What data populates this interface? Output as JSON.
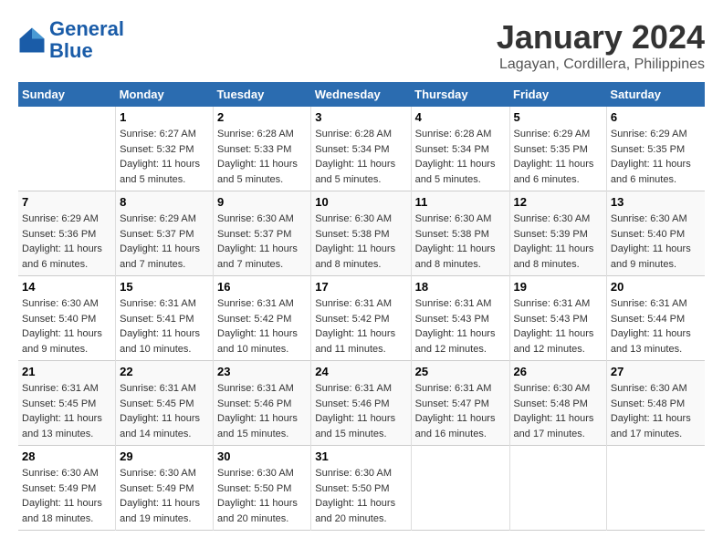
{
  "logo": {
    "line1": "General",
    "line2": "Blue"
  },
  "title": "January 2024",
  "location": "Lagayan, Cordillera, Philippines",
  "days_header": [
    "Sunday",
    "Monday",
    "Tuesday",
    "Wednesday",
    "Thursday",
    "Friday",
    "Saturday"
  ],
  "weeks": [
    [
      {
        "day": "",
        "sunrise": "",
        "sunset": "",
        "daylight": ""
      },
      {
        "day": "1",
        "sunrise": "Sunrise: 6:27 AM",
        "sunset": "Sunset: 5:32 PM",
        "daylight": "Daylight: 11 hours and 5 minutes."
      },
      {
        "day": "2",
        "sunrise": "Sunrise: 6:28 AM",
        "sunset": "Sunset: 5:33 PM",
        "daylight": "Daylight: 11 hours and 5 minutes."
      },
      {
        "day": "3",
        "sunrise": "Sunrise: 6:28 AM",
        "sunset": "Sunset: 5:34 PM",
        "daylight": "Daylight: 11 hours and 5 minutes."
      },
      {
        "day": "4",
        "sunrise": "Sunrise: 6:28 AM",
        "sunset": "Sunset: 5:34 PM",
        "daylight": "Daylight: 11 hours and 5 minutes."
      },
      {
        "day": "5",
        "sunrise": "Sunrise: 6:29 AM",
        "sunset": "Sunset: 5:35 PM",
        "daylight": "Daylight: 11 hours and 6 minutes."
      },
      {
        "day": "6",
        "sunrise": "Sunrise: 6:29 AM",
        "sunset": "Sunset: 5:35 PM",
        "daylight": "Daylight: 11 hours and 6 minutes."
      }
    ],
    [
      {
        "day": "7",
        "sunrise": "Sunrise: 6:29 AM",
        "sunset": "Sunset: 5:36 PM",
        "daylight": "Daylight: 11 hours and 6 minutes."
      },
      {
        "day": "8",
        "sunrise": "Sunrise: 6:29 AM",
        "sunset": "Sunset: 5:37 PM",
        "daylight": "Daylight: 11 hours and 7 minutes."
      },
      {
        "day": "9",
        "sunrise": "Sunrise: 6:30 AM",
        "sunset": "Sunset: 5:37 PM",
        "daylight": "Daylight: 11 hours and 7 minutes."
      },
      {
        "day": "10",
        "sunrise": "Sunrise: 6:30 AM",
        "sunset": "Sunset: 5:38 PM",
        "daylight": "Daylight: 11 hours and 8 minutes."
      },
      {
        "day": "11",
        "sunrise": "Sunrise: 6:30 AM",
        "sunset": "Sunset: 5:38 PM",
        "daylight": "Daylight: 11 hours and 8 minutes."
      },
      {
        "day": "12",
        "sunrise": "Sunrise: 6:30 AM",
        "sunset": "Sunset: 5:39 PM",
        "daylight": "Daylight: 11 hours and 8 minutes."
      },
      {
        "day": "13",
        "sunrise": "Sunrise: 6:30 AM",
        "sunset": "Sunset: 5:40 PM",
        "daylight": "Daylight: 11 hours and 9 minutes."
      }
    ],
    [
      {
        "day": "14",
        "sunrise": "Sunrise: 6:30 AM",
        "sunset": "Sunset: 5:40 PM",
        "daylight": "Daylight: 11 hours and 9 minutes."
      },
      {
        "day": "15",
        "sunrise": "Sunrise: 6:31 AM",
        "sunset": "Sunset: 5:41 PM",
        "daylight": "Daylight: 11 hours and 10 minutes."
      },
      {
        "day": "16",
        "sunrise": "Sunrise: 6:31 AM",
        "sunset": "Sunset: 5:42 PM",
        "daylight": "Daylight: 11 hours and 10 minutes."
      },
      {
        "day": "17",
        "sunrise": "Sunrise: 6:31 AM",
        "sunset": "Sunset: 5:42 PM",
        "daylight": "Daylight: 11 hours and 11 minutes."
      },
      {
        "day": "18",
        "sunrise": "Sunrise: 6:31 AM",
        "sunset": "Sunset: 5:43 PM",
        "daylight": "Daylight: 11 hours and 12 minutes."
      },
      {
        "day": "19",
        "sunrise": "Sunrise: 6:31 AM",
        "sunset": "Sunset: 5:43 PM",
        "daylight": "Daylight: 11 hours and 12 minutes."
      },
      {
        "day": "20",
        "sunrise": "Sunrise: 6:31 AM",
        "sunset": "Sunset: 5:44 PM",
        "daylight": "Daylight: 11 hours and 13 minutes."
      }
    ],
    [
      {
        "day": "21",
        "sunrise": "Sunrise: 6:31 AM",
        "sunset": "Sunset: 5:45 PM",
        "daylight": "Daylight: 11 hours and 13 minutes."
      },
      {
        "day": "22",
        "sunrise": "Sunrise: 6:31 AM",
        "sunset": "Sunset: 5:45 PM",
        "daylight": "Daylight: 11 hours and 14 minutes."
      },
      {
        "day": "23",
        "sunrise": "Sunrise: 6:31 AM",
        "sunset": "Sunset: 5:46 PM",
        "daylight": "Daylight: 11 hours and 15 minutes."
      },
      {
        "day": "24",
        "sunrise": "Sunrise: 6:31 AM",
        "sunset": "Sunset: 5:46 PM",
        "daylight": "Daylight: 11 hours and 15 minutes."
      },
      {
        "day": "25",
        "sunrise": "Sunrise: 6:31 AM",
        "sunset": "Sunset: 5:47 PM",
        "daylight": "Daylight: 11 hours and 16 minutes."
      },
      {
        "day": "26",
        "sunrise": "Sunrise: 6:30 AM",
        "sunset": "Sunset: 5:48 PM",
        "daylight": "Daylight: 11 hours and 17 minutes."
      },
      {
        "day": "27",
        "sunrise": "Sunrise: 6:30 AM",
        "sunset": "Sunset: 5:48 PM",
        "daylight": "Daylight: 11 hours and 17 minutes."
      }
    ],
    [
      {
        "day": "28",
        "sunrise": "Sunrise: 6:30 AM",
        "sunset": "Sunset: 5:49 PM",
        "daylight": "Daylight: 11 hours and 18 minutes."
      },
      {
        "day": "29",
        "sunrise": "Sunrise: 6:30 AM",
        "sunset": "Sunset: 5:49 PM",
        "daylight": "Daylight: 11 hours and 19 minutes."
      },
      {
        "day": "30",
        "sunrise": "Sunrise: 6:30 AM",
        "sunset": "Sunset: 5:50 PM",
        "daylight": "Daylight: 11 hours and 20 minutes."
      },
      {
        "day": "31",
        "sunrise": "Sunrise: 6:30 AM",
        "sunset": "Sunset: 5:50 PM",
        "daylight": "Daylight: 11 hours and 20 minutes."
      },
      {
        "day": "",
        "sunrise": "",
        "sunset": "",
        "daylight": ""
      },
      {
        "day": "",
        "sunrise": "",
        "sunset": "",
        "daylight": ""
      },
      {
        "day": "",
        "sunrise": "",
        "sunset": "",
        "daylight": ""
      }
    ]
  ]
}
